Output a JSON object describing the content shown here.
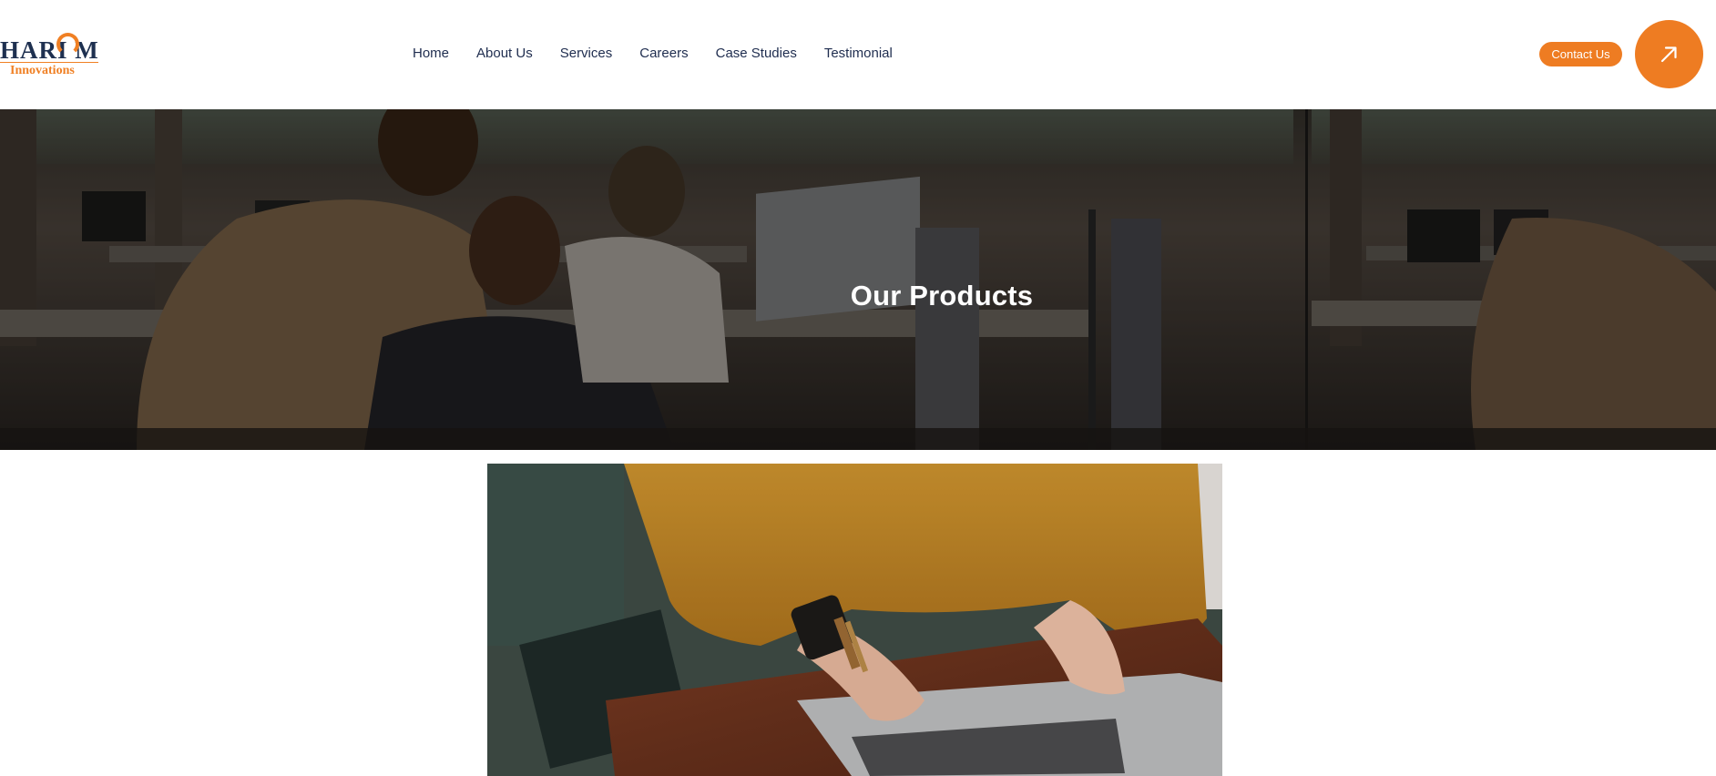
{
  "brand": {
    "logo_main": "HARIOM",
    "logo_sub": "Innovations",
    "accent_color": "#ee7c22",
    "text_color": "#1f2d4f"
  },
  "nav": {
    "items": [
      {
        "label": "Home"
      },
      {
        "label": "About Us"
      },
      {
        "label": "Services"
      },
      {
        "label": "Careers"
      },
      {
        "label": "Case Studies"
      },
      {
        "label": "Testimonial"
      }
    ]
  },
  "header": {
    "contact_label": "Contact Us",
    "circle_icon": "arrow-up-right-icon"
  },
  "hero": {
    "title": "Our Products",
    "image": "office-team-at-computers-photo"
  },
  "content": {
    "image": "person-typing-on-laptop-photo"
  }
}
